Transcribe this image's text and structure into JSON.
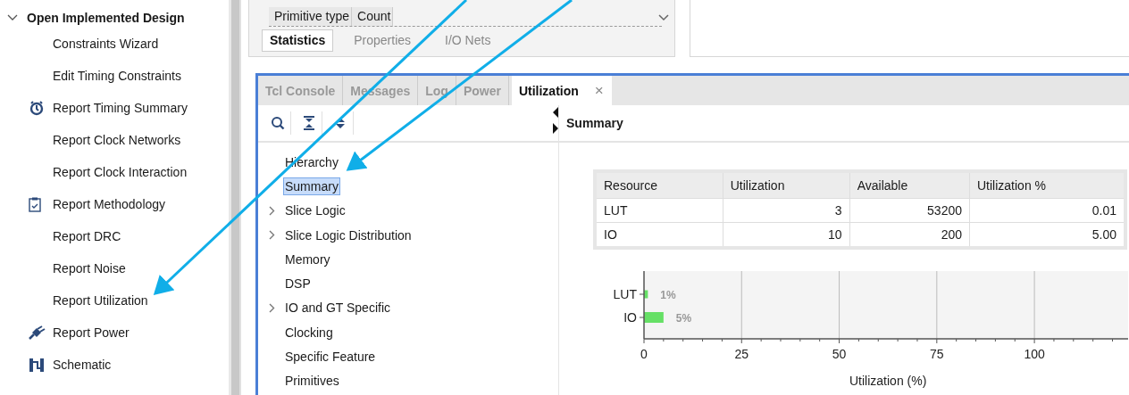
{
  "flow_navigator": {
    "section": {
      "label": "Open Implemented Design",
      "expanded": true
    },
    "items": [
      {
        "label": "Constraints Wizard",
        "kind": "plain"
      },
      {
        "label": "Edit Timing Constraints",
        "kind": "plain"
      },
      {
        "label": "Report Timing Summary",
        "kind": "timer"
      },
      {
        "label": "Report Clock Networks",
        "kind": "plain"
      },
      {
        "label": "Report Clock Interaction",
        "kind": "plain"
      },
      {
        "label": "Report Methodology",
        "kind": "checklist"
      },
      {
        "label": "Report DRC",
        "kind": "plain"
      },
      {
        "label": "Report Noise",
        "kind": "plain"
      },
      {
        "label": "Report Utilization",
        "kind": "plain"
      },
      {
        "label": "Report Power",
        "kind": "plug"
      },
      {
        "label": "Schematic",
        "kind": "schematic"
      }
    ]
  },
  "netlist_panel": {
    "columns": [
      "Primitive type",
      "Count"
    ],
    "tabs": [
      {
        "label": "Statistics",
        "selected": true
      },
      {
        "label": "Properties",
        "selected": false
      },
      {
        "label": "I/O Nets",
        "selected": false
      }
    ]
  },
  "bottom_panel": {
    "tabs": [
      {
        "label": "Tcl Console",
        "selected": false,
        "closable": false
      },
      {
        "label": "Messages",
        "selected": false,
        "closable": false
      },
      {
        "label": "Log",
        "selected": false,
        "closable": false
      },
      {
        "label": "Power",
        "selected": false,
        "closable": false
      },
      {
        "label": "Utilization",
        "selected": true,
        "closable": true
      }
    ],
    "close_glyph": "×",
    "tree": [
      {
        "label": "Hierarchy",
        "expandable": false,
        "selected": false
      },
      {
        "label": "Summary",
        "expandable": false,
        "selected": true
      },
      {
        "label": "Slice Logic",
        "expandable": true,
        "selected": false
      },
      {
        "label": "Slice Logic Distribution",
        "expandable": true,
        "selected": false
      },
      {
        "label": "Memory",
        "expandable": false,
        "selected": false
      },
      {
        "label": "DSP",
        "expandable": false,
        "selected": false
      },
      {
        "label": "IO and GT Specific",
        "expandable": true,
        "selected": false
      },
      {
        "label": "Clocking",
        "expandable": false,
        "selected": false
      },
      {
        "label": "Specific Feature",
        "expandable": false,
        "selected": false
      },
      {
        "label": "Primitives",
        "expandable": false,
        "selected": false
      }
    ],
    "content_title": "Summary",
    "table": {
      "columns": [
        "Resource",
        "Utilization",
        "Available",
        "Utilization %"
      ],
      "rows": [
        [
          "LUT",
          "3",
          "53200",
          "0.01"
        ],
        [
          "IO",
          "10",
          "200",
          "5.00"
        ]
      ]
    },
    "chart_data": {
      "type": "bar",
      "orientation": "horizontal",
      "xlabel": "Utilization (%)",
      "categories": [
        "LUT",
        "IO"
      ],
      "series": [
        {
          "color": "#66e066",
          "values": [
            1,
            5
          ]
        }
      ],
      "grid": true,
      "xlim": [
        0,
        124
      ],
      "xticks": [
        0,
        25,
        50,
        75,
        100
      ],
      "value_labels": [
        "1%",
        "5%"
      ]
    }
  }
}
